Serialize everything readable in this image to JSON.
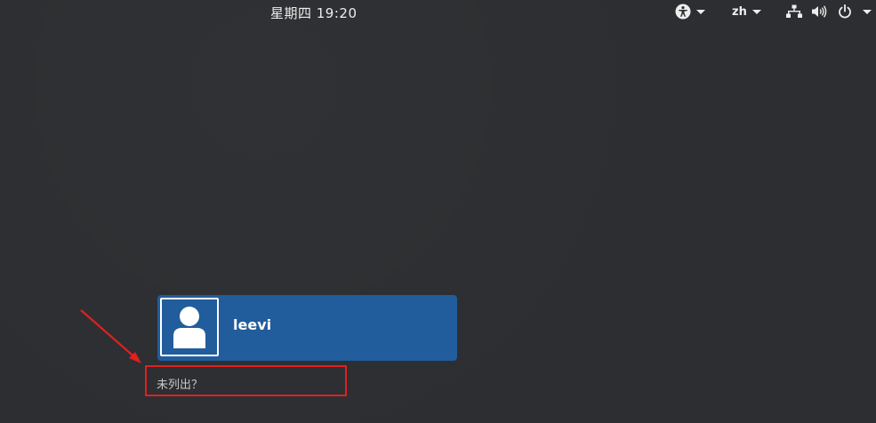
{
  "topbar": {
    "clock": "星期四 19:20",
    "language": "zh",
    "icons": {
      "accessibility": "accessibility-icon",
      "network": "network-wired-icon",
      "volume": "volume-icon",
      "power": "power-icon"
    }
  },
  "login": {
    "user": {
      "name": "leevi",
      "avatar_icon": "user-avatar-icon"
    },
    "not_listed_label": "未列出？"
  },
  "colors": {
    "background": "#2c2e31",
    "user_card": "#215d9c",
    "annotation": "#e02020",
    "text": "#eeeeec"
  }
}
